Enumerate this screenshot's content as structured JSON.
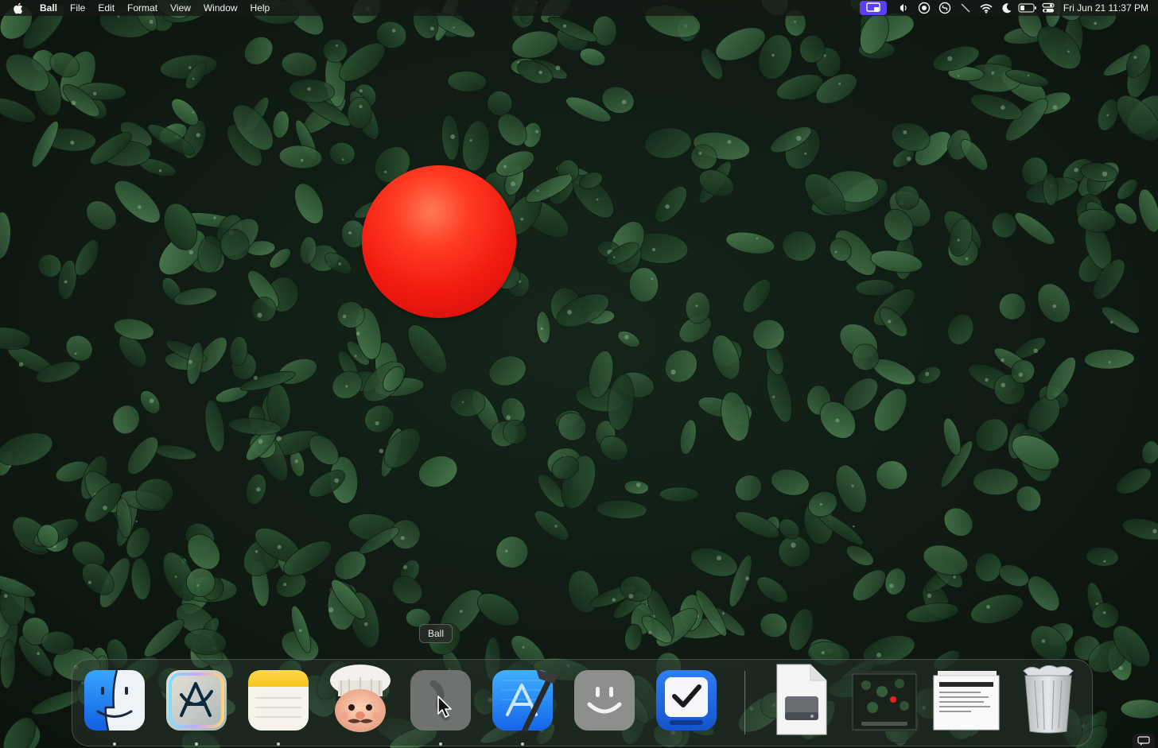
{
  "menubar": {
    "app_name": "Ball",
    "menus": [
      "File",
      "Edit",
      "Format",
      "View",
      "Window",
      "Help"
    ],
    "status_icons": [
      "screen-mirroring-icon",
      "focus-icon",
      "record-icon",
      "shazam-icon",
      "slash-icon",
      "wifi-icon",
      "moon-icon",
      "battery-icon",
      "control-center-icon"
    ],
    "clock": "Fri Jun 21  11:37 PM"
  },
  "desktop": {
    "wallpaper": "green-leaves-wallpaper",
    "ball_color": "#f01a10"
  },
  "dock": {
    "tooltip": "Ball",
    "apps": [
      {
        "name": "Finder",
        "icon": "finder-icon",
        "running": true
      },
      {
        "name": "Script Editor",
        "icon": "script-editor-icon",
        "running": true
      },
      {
        "name": "Notes",
        "icon": "notes-icon",
        "running": true
      },
      {
        "name": "Chef",
        "icon": "chef-icon",
        "running": false
      },
      {
        "name": "Ball",
        "icon": "ball-app-icon",
        "running": true
      },
      {
        "name": "Xcode",
        "icon": "xcode-icon",
        "running": true
      },
      {
        "name": "Smile",
        "icon": "smile-app-icon",
        "running": false
      },
      {
        "name": "Tasks",
        "icon": "tasks-checkbox-icon",
        "running": false
      }
    ],
    "others": [
      {
        "name": "Disk Image",
        "icon": "disk-image-icon"
      },
      {
        "name": "Screenshot",
        "icon": "screenshot-stack-icon"
      },
      {
        "name": "Document",
        "icon": "document-stack-icon"
      },
      {
        "name": "Trash",
        "icon": "trash-full-icon"
      }
    ]
  }
}
